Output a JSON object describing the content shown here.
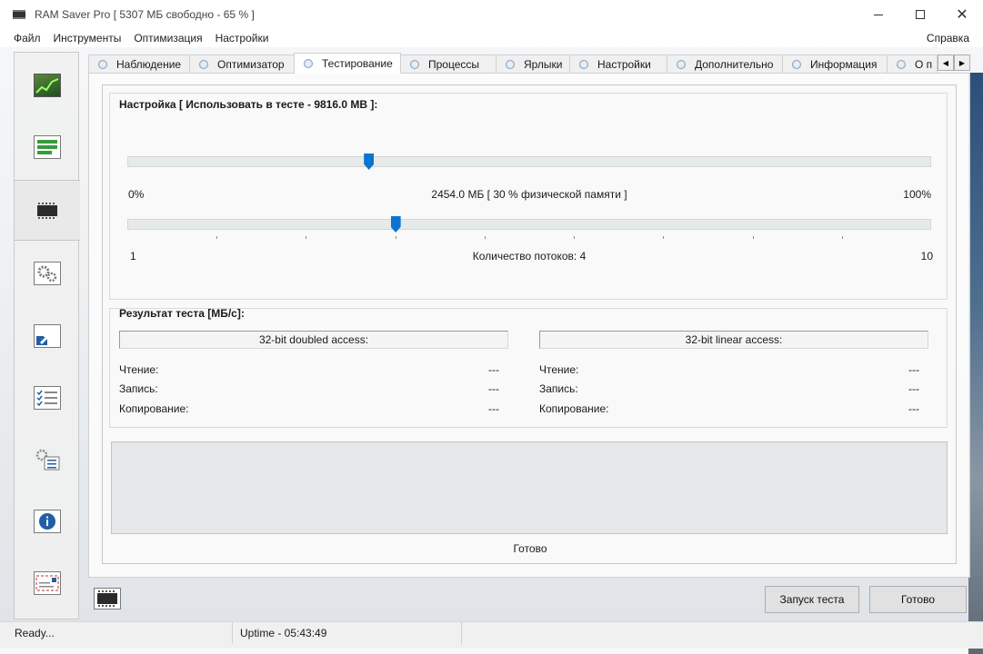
{
  "window": {
    "title": "RAM Saver Pro [ 5307 МБ свободно - 65 % ]",
    "min_icon": "minimize-icon",
    "max_icon": "maximize-icon",
    "close_glyph": "✕"
  },
  "menu": {
    "items": [
      "Файл",
      "Инструменты",
      "Оптимизация",
      "Настройки"
    ],
    "help": "Справка"
  },
  "sidebar": {
    "items": [
      {
        "icon": "monitor-chart-icon"
      },
      {
        "icon": "optimizer-bars-icon"
      },
      {
        "icon": "memory-chip-icon",
        "active": true
      },
      {
        "icon": "gears-icon"
      },
      {
        "icon": "shortcut-arrow-icon"
      },
      {
        "icon": "checklist-icon"
      },
      {
        "icon": "settings-list-icon"
      },
      {
        "icon": "info-icon"
      },
      {
        "icon": "about-card-icon"
      }
    ]
  },
  "tabs": [
    {
      "label": "Наблюдение"
    },
    {
      "label": "Оптимизатор"
    },
    {
      "label": "Тестирование",
      "active": true
    },
    {
      "label": "Процессы"
    },
    {
      "label": "Ярлыки"
    },
    {
      "label": "Настройки"
    },
    {
      "label": "Дополнительно"
    },
    {
      "label": "Информация"
    },
    {
      "label": "О п"
    }
  ],
  "tab_scroll": {
    "left": "◀",
    "right": "▶"
  },
  "settings": {
    "title": "Настройка [ Использовать в тесте - 9816.0 MB ]:",
    "memory_slider": {
      "min_label": "0%",
      "max_label": "100%",
      "value_label": "2454.0 МБ [ 30 % физической памяти ]",
      "value_percent": 30
    },
    "threads_slider": {
      "min_label": "1",
      "max_label": "10",
      "value_label": "Количество потоков: 4",
      "value": 4,
      "min": 1,
      "max": 10
    }
  },
  "results": {
    "title": "Результат теста [МБ/с]:",
    "left": {
      "header": "32-bit doubled access:",
      "rows": [
        {
          "label": "Чтение:",
          "value": "---"
        },
        {
          "label": "Запись:",
          "value": "---"
        },
        {
          "label": "Копирование:",
          "value": "---"
        }
      ]
    },
    "right": {
      "header": "32-bit linear access:",
      "rows": [
        {
          "label": "Чтение:",
          "value": "---"
        },
        {
          "label": "Запись:",
          "value": "---"
        },
        {
          "label": "Копирование:",
          "value": "---"
        }
      ]
    },
    "status": "Готово"
  },
  "footer": {
    "start_button": "Запуск теста",
    "done_button": "Готово"
  },
  "statusbar": {
    "left": "Ready...",
    "uptime": "Uptime - 05:43:49"
  },
  "colors": {
    "accent": "#0a74d0"
  }
}
